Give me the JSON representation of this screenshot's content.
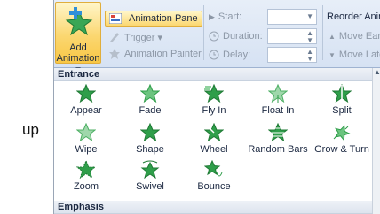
{
  "side_label": "up",
  "ribbon": {
    "add_animation": {
      "line1": "Add",
      "line2": "Animation",
      "caret": "▾",
      "icon": "star-plus-icon"
    },
    "animation_pane": "Animation Pane",
    "trigger": "Trigger ▾",
    "animation_painter": "Animation Painter",
    "start_label": "Start:",
    "duration_label": "Duration:",
    "delay_label": "Delay:",
    "reorder_title": "Reorder Anima",
    "move_earlier": "Move Earl",
    "move_later": "Move Late"
  },
  "gallery": {
    "entrance_header": "Entrance",
    "emphasis_header": "Emphasis",
    "items": [
      {
        "label": "Appear",
        "icon": "star-appear-icon"
      },
      {
        "label": "Fade",
        "icon": "star-fade-icon"
      },
      {
        "label": "Fly In",
        "icon": "star-fly-in-icon"
      },
      {
        "label": "Float In",
        "icon": "star-float-in-icon"
      },
      {
        "label": "Split",
        "icon": "star-split-icon"
      },
      {
        "label": "Wipe",
        "icon": "star-wipe-icon"
      },
      {
        "label": "Shape",
        "icon": "star-shape-icon"
      },
      {
        "label": "Wheel",
        "icon": "star-wheel-icon"
      },
      {
        "label": "Random Bars",
        "icon": "star-random-bars-icon"
      },
      {
        "label": "Grow & Turn",
        "icon": "star-grow-turn-icon"
      },
      {
        "label": "Zoom",
        "icon": "star-zoom-icon"
      },
      {
        "label": "Swivel",
        "icon": "star-swivel-icon"
      },
      {
        "label": "Bounce",
        "icon": "star-bounce-icon"
      }
    ]
  },
  "colors": {
    "star_green": "#2f9e4a",
    "star_dark": "#1f7a35",
    "highlight": "#fbd771"
  }
}
